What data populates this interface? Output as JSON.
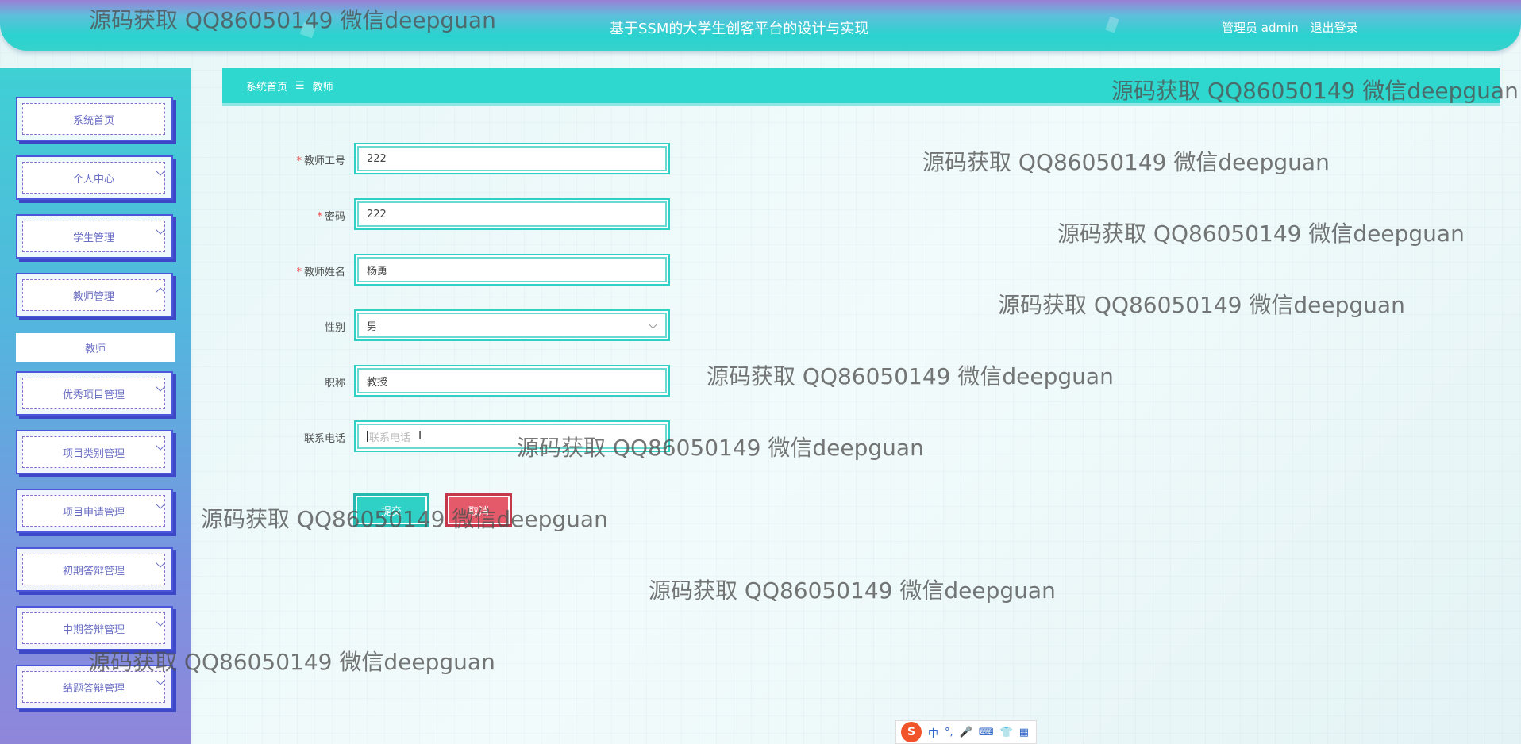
{
  "header": {
    "title": "基于SSM的大学生创客平台的设计与实现",
    "role_user": "管理员 admin",
    "logout": "退出登录"
  },
  "sidebar": {
    "items": [
      {
        "label": "系统首页",
        "chevron": ""
      },
      {
        "label": "个人中心",
        "chevron": "down"
      },
      {
        "label": "学生管理",
        "chevron": "down"
      },
      {
        "label": "教师管理",
        "chevron": "up"
      },
      {
        "label": "优秀项目管理",
        "chevron": "down"
      },
      {
        "label": "项目类别管理",
        "chevron": "down"
      },
      {
        "label": "项目申请管理",
        "chevron": "down"
      },
      {
        "label": "初期答辩管理",
        "chevron": "down"
      },
      {
        "label": "中期答辩管理",
        "chevron": "down"
      },
      {
        "label": "结题答辩管理",
        "chevron": "down"
      }
    ],
    "submenu_active": "教师"
  },
  "breadcrumb": {
    "home": "系统首页",
    "separator": "☰",
    "current": "教师"
  },
  "form": {
    "fields": [
      {
        "label": "教师工号",
        "required": true,
        "value": "222"
      },
      {
        "label": "密码",
        "required": true,
        "value": "222"
      },
      {
        "label": "教师姓名",
        "required": true,
        "value": "杨勇"
      },
      {
        "label": "性别",
        "required": false,
        "value": "男",
        "type": "select"
      },
      {
        "label": "职称",
        "required": false,
        "value": "教授"
      },
      {
        "label": "联系电话",
        "required": false,
        "value": "",
        "placeholder": "联系电话"
      }
    ],
    "submit_label": "提交",
    "cancel_label": "取消"
  },
  "watermark": "源码获取 QQ86050149 微信deepguan",
  "ime": {
    "logo": "S",
    "mode": "中",
    "punct": "°,"
  },
  "colors": {
    "accent": "#2fd0c6",
    "sidebar_top": "#3fd0d4",
    "sidebar_bottom": "#8f86da",
    "cancel": "#e45a6a",
    "required": "#f04a4a"
  }
}
